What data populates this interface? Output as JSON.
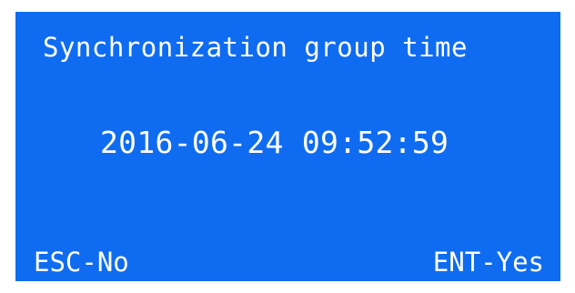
{
  "screen": {
    "background_color": "#0f6cf0",
    "text_color": "#ffffff",
    "title": "Synchronization group time",
    "datetime": "2016-06-24 09:52:59"
  },
  "softkeys": {
    "left_label": "ESC-No",
    "right_label": "ENT-Yes"
  }
}
